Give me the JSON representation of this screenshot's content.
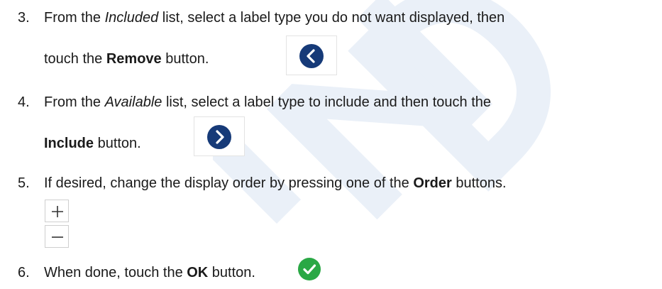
{
  "steps": [
    {
      "number": "3.",
      "line1": {
        "t1": "From the ",
        "em": "Included",
        "t2": " list, select a label type you do not want displayed, then"
      },
      "line2": {
        "t1": "touch the ",
        "strong": "Remove",
        "t2": " button."
      },
      "icon": "chevron-left-icon"
    },
    {
      "number": "4.",
      "line1": {
        "t1": "From the ",
        "em": "Available",
        "t2": " list, select a label type to include and then touch the"
      },
      "line2": {
        "strong": "Include",
        "t2": " button."
      },
      "icon": "chevron-right-icon"
    },
    {
      "number": "5.",
      "line1": {
        "t1": "If desired, change the display order by pressing one of the ",
        "strong": "Order",
        "t2": " buttons."
      },
      "icons": [
        "plus-icon",
        "minus-icon"
      ]
    },
    {
      "number": "6.",
      "line1": {
        "t1": "When done, touch the ",
        "strong": "OK",
        "t2": " button."
      },
      "icon": "check-circle-icon"
    }
  ],
  "colors": {
    "button_blue": "#163a78",
    "ok_green": "#2aa845",
    "watermark": "#e9eef7"
  }
}
